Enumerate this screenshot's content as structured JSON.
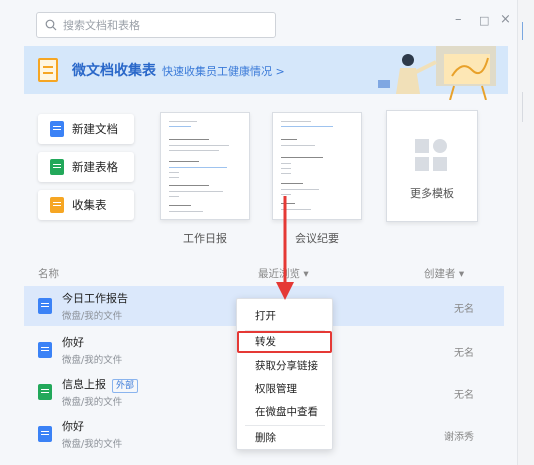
{
  "search": {
    "placeholder": "搜索文档和表格"
  },
  "window_controls": {
    "minimize": "–",
    "maximize": "□",
    "close": "×"
  },
  "banner": {
    "title": "微文档收集表",
    "link": "快速收集员工健康情况 >"
  },
  "new_buttons": [
    {
      "label": "新建文档",
      "color": "#3b82f6"
    },
    {
      "label": "新建表格",
      "color": "#22a85a"
    },
    {
      "label": "收集表",
      "color": "#f6a623"
    }
  ],
  "templates": [
    {
      "label": "工作日报"
    },
    {
      "label": "会议纪要"
    }
  ],
  "more_templates": {
    "label": "更多模板"
  },
  "list_header": {
    "name": "名称",
    "recent": "最近浏览 ▾",
    "creator": "创建者 ▾"
  },
  "rows": [
    {
      "name": "今日工作报告",
      "path": "微盘/我的文件",
      "owner": "无名",
      "tag": "",
      "icon_color": "#3b82f6"
    },
    {
      "name": "你好",
      "path": "微盘/我的文件",
      "owner": "无名",
      "tag": "",
      "icon_color": "#3b82f6"
    },
    {
      "name": "信息上报",
      "path": "微盘/我的文件",
      "owner": "无名",
      "tag": "外部",
      "icon_color": "#22a85a"
    },
    {
      "name": "你好",
      "path": "微盘/我的文件",
      "owner": "谢添秀",
      "tag": "",
      "icon_color": "#3b82f6"
    }
  ],
  "context_menu": {
    "items": [
      "打开",
      "转发",
      "获取分享链接",
      "权限管理",
      "在微盘中查看",
      "删除"
    ],
    "highlighted": "转发"
  },
  "colors": {
    "accent": "#2a68c9",
    "highlight_border": "#e53935",
    "selected_row": "#dbe8fb",
    "banner_bg": "#d5e7fa"
  }
}
